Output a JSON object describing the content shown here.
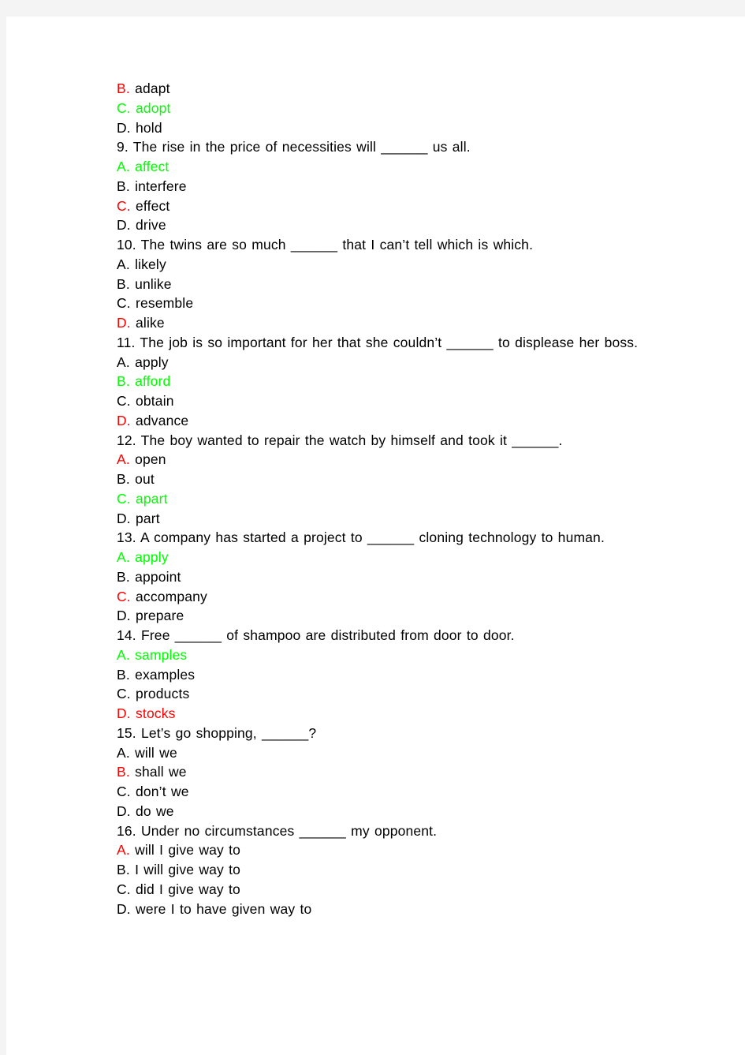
{
  "page": {
    "background_color": "#f4f4f4",
    "paper_color": "#ffffff",
    "text_color": "#000000",
    "correct_color": "#00ff00",
    "marked_color": "#ff0000",
    "blank_token": "______"
  },
  "lines": [
    {
      "id": "q8-opt-b",
      "kind": "option",
      "tag": "B.",
      "tag_color": "red",
      "text": "adapt",
      "text_color": "black"
    },
    {
      "id": "q8-opt-c",
      "kind": "option",
      "tag": "C.",
      "tag_color": "green",
      "text": "adopt",
      "text_color": "green"
    },
    {
      "id": "q8-opt-d",
      "kind": "option",
      "tag": "D.",
      "tag_color": "black",
      "text": "hold",
      "text_color": "black"
    },
    {
      "id": "q9-stem",
      "kind": "stem",
      "tag": "",
      "tag_color": "black",
      "text": "9. The rise in the price of necessities will ______ us all.",
      "text_color": "black"
    },
    {
      "id": "q9-opt-a",
      "kind": "option",
      "tag": "A.",
      "tag_color": "green",
      "text": "affect",
      "text_color": "green"
    },
    {
      "id": "q9-opt-b",
      "kind": "option",
      "tag": "B.",
      "tag_color": "black",
      "text": "interfere",
      "text_color": "black"
    },
    {
      "id": "q9-opt-c",
      "kind": "option",
      "tag": "C.",
      "tag_color": "red",
      "text": "effect",
      "text_color": "black"
    },
    {
      "id": "q9-opt-d",
      "kind": "option",
      "tag": "D.",
      "tag_color": "black",
      "text": "drive",
      "text_color": "black"
    },
    {
      "id": "q10-stem",
      "kind": "stem",
      "tag": "",
      "tag_color": "black",
      "text": "10. The twins are so much ______ that I can’t tell which is which.",
      "text_color": "black"
    },
    {
      "id": "q10-opt-a",
      "kind": "option",
      "tag": "A.",
      "tag_color": "black",
      "text": "likely",
      "text_color": "black"
    },
    {
      "id": "q10-opt-b",
      "kind": "option",
      "tag": "B.",
      "tag_color": "black",
      "text": "unlike",
      "text_color": "black"
    },
    {
      "id": "q10-opt-c",
      "kind": "option",
      "tag": "C.",
      "tag_color": "black",
      "text": "resemble",
      "text_color": "black"
    },
    {
      "id": "q10-opt-d",
      "kind": "option",
      "tag": "D.",
      "tag_color": "red",
      "text": "alike",
      "text_color": "black"
    },
    {
      "id": "q11-stem",
      "kind": "stem",
      "tag": "",
      "tag_color": "black",
      "text": "11. The job is so important for her that she couldn’t ______ to displease her boss.",
      "text_color": "black"
    },
    {
      "id": "q11-opt-a",
      "kind": "option",
      "tag": "A.",
      "tag_color": "black",
      "text": "apply",
      "text_color": "black"
    },
    {
      "id": "q11-opt-b",
      "kind": "option",
      "tag": "B.",
      "tag_color": "green",
      "text": "afford",
      "text_color": "green"
    },
    {
      "id": "q11-opt-c",
      "kind": "option",
      "tag": "C.",
      "tag_color": "black",
      "text": "obtain",
      "text_color": "black"
    },
    {
      "id": "q11-opt-d",
      "kind": "option",
      "tag": "D.",
      "tag_color": "red",
      "text": "advance",
      "text_color": "black"
    },
    {
      "id": "q12-stem",
      "kind": "stem",
      "tag": "",
      "tag_color": "black",
      "text": "12. The boy wanted to repair the watch by himself and took it ______.",
      "text_color": "black"
    },
    {
      "id": "q12-opt-a",
      "kind": "option",
      "tag": "A.",
      "tag_color": "red",
      "text": "open",
      "text_color": "black"
    },
    {
      "id": "q12-opt-b",
      "kind": "option",
      "tag": "B.",
      "tag_color": "black",
      "text": "out",
      "text_color": "black"
    },
    {
      "id": "q12-opt-c",
      "kind": "option",
      "tag": "C.",
      "tag_color": "green",
      "text": "apart",
      "text_color": "green"
    },
    {
      "id": "q12-opt-d",
      "kind": "option",
      "tag": "D.",
      "tag_color": "black",
      "text": "part",
      "text_color": "black"
    },
    {
      "id": "q13-stem",
      "kind": "stem",
      "tag": "",
      "tag_color": "black",
      "text": "13. A company has started a project to ______ cloning technology to human.",
      "text_color": "black"
    },
    {
      "id": "q13-opt-a",
      "kind": "option",
      "tag": "A.",
      "tag_color": "green",
      "text": "apply",
      "text_color": "green"
    },
    {
      "id": "q13-opt-b",
      "kind": "option",
      "tag": "B.",
      "tag_color": "black",
      "text": "appoint",
      "text_color": "black"
    },
    {
      "id": "q13-opt-c",
      "kind": "option",
      "tag": "C.",
      "tag_color": "red",
      "text": "accompany",
      "text_color": "black"
    },
    {
      "id": "q13-opt-d",
      "kind": "option",
      "tag": "D.",
      "tag_color": "black",
      "text": "prepare",
      "text_color": "black"
    },
    {
      "id": "q14-stem",
      "kind": "stem",
      "tag": "",
      "tag_color": "black",
      "text": "14. Free ______ of shampoo are distributed from door to door.",
      "text_color": "black"
    },
    {
      "id": "q14-opt-a",
      "kind": "option",
      "tag": "A.",
      "tag_color": "green",
      "text": "samples",
      "text_color": "green"
    },
    {
      "id": "q14-opt-b",
      "kind": "option",
      "tag": "B.",
      "tag_color": "black",
      "text": "examples",
      "text_color": "black"
    },
    {
      "id": "q14-opt-c",
      "kind": "option",
      "tag": "C.",
      "tag_color": "black",
      "text": "products",
      "text_color": "black"
    },
    {
      "id": "q14-opt-d",
      "kind": "option",
      "tag": "D.",
      "tag_color": "red",
      "text": "stocks",
      "text_color": "red"
    },
    {
      "id": "q15-stem",
      "kind": "stem",
      "tag": "",
      "tag_color": "black",
      "text": "15. Let’s go shopping, ______?",
      "text_color": "black"
    },
    {
      "id": "q15-opt-a",
      "kind": "option",
      "tag": "A.",
      "tag_color": "black",
      "text": "will we",
      "text_color": "black"
    },
    {
      "id": "q15-opt-b",
      "kind": "option",
      "tag": "B.",
      "tag_color": "red",
      "text": "shall we",
      "text_color": "black"
    },
    {
      "id": "q15-opt-c",
      "kind": "option",
      "tag": "C.",
      "tag_color": "black",
      "text": "don’t we",
      "text_color": "black"
    },
    {
      "id": "q15-opt-d",
      "kind": "option",
      "tag": "D.",
      "tag_color": "black",
      "text": "do we",
      "text_color": "black"
    },
    {
      "id": "q16-stem",
      "kind": "stem",
      "tag": "",
      "tag_color": "black",
      "text": "16. Under no circumstances ______ my opponent.",
      "text_color": "black"
    },
    {
      "id": "q16-opt-a",
      "kind": "option",
      "tag": "A.",
      "tag_color": "red",
      "text": "will I give way to",
      "text_color": "black"
    },
    {
      "id": "q16-opt-b",
      "kind": "option",
      "tag": "B.",
      "tag_color": "black",
      "text": "I will give way to",
      "text_color": "black"
    },
    {
      "id": "q16-opt-c",
      "kind": "option",
      "tag": "C.",
      "tag_color": "black",
      "text": "did I give way to",
      "text_color": "black"
    },
    {
      "id": "q16-opt-d",
      "kind": "option",
      "tag": "D.",
      "tag_color": "black",
      "text": "were I to have given way to",
      "text_color": "black"
    }
  ]
}
